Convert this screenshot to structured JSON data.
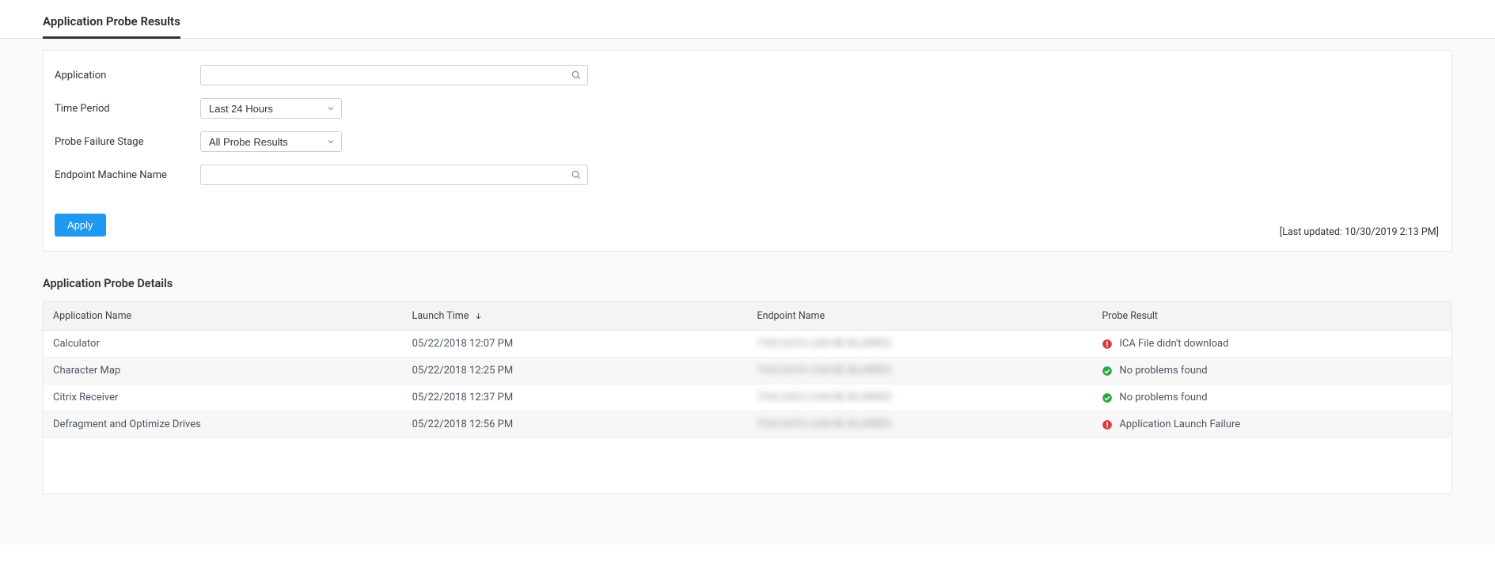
{
  "page": {
    "title": "Application Probe Results"
  },
  "filters": {
    "application": {
      "label": "Application",
      "value": "",
      "placeholder": ""
    },
    "time_period": {
      "label": "Time Period",
      "selected": "Last 24 Hours"
    },
    "probe_failure_stage": {
      "label": "Probe Failure Stage",
      "selected": "All Probe Results"
    },
    "endpoint_machine": {
      "label": "Endpoint Machine Name",
      "value": "",
      "placeholder": ""
    },
    "apply_label": "Apply",
    "last_updated": "[Last updated: 10/30/2019 2:13 PM]"
  },
  "details": {
    "section_title": "Application Probe Details",
    "columns": {
      "app": "Application Name",
      "launch": "Launch Time",
      "endpoint": "Endpoint Name",
      "result": "Probe Result"
    },
    "rows": [
      {
        "app": "Calculator",
        "launch": "05/22/2018 12:07 PM",
        "endpoint": "THIS DATA CAN BE BLURRED",
        "result_status": "error",
        "result_text": "ICA File didn't download"
      },
      {
        "app": "Character Map",
        "launch": "05/22/2018 12:25 PM",
        "endpoint": "THIS DATA CAN BE BLURRED",
        "result_status": "ok",
        "result_text": "No problems found"
      },
      {
        "app": "Citrix Receiver",
        "launch": "05/22/2018 12:37 PM",
        "endpoint": "THIS DATA CAN BE BLURRED",
        "result_status": "ok",
        "result_text": "No problems found"
      },
      {
        "app": "Defragment and Optimize Drives",
        "launch": "05/22/2018 12:56 PM",
        "endpoint": "THIS DATA CAN BE BLURRED",
        "result_status": "error",
        "result_text": "Application Launch Failure"
      }
    ]
  }
}
